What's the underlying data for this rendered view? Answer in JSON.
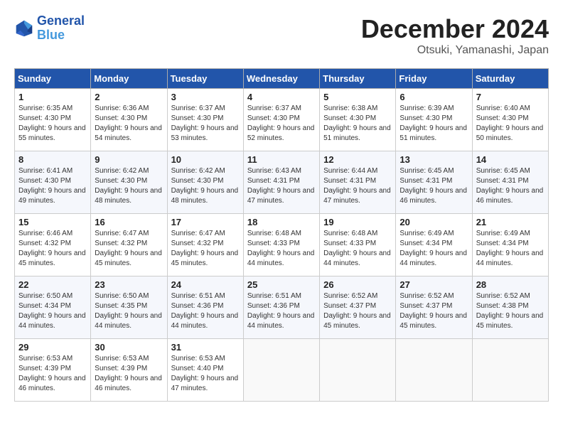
{
  "logo": {
    "line1": "General",
    "line2": "Blue"
  },
  "title": "December 2024",
  "location": "Otsuki, Yamanashi, Japan",
  "days_of_week": [
    "Sunday",
    "Monday",
    "Tuesday",
    "Wednesday",
    "Thursday",
    "Friday",
    "Saturday"
  ],
  "weeks": [
    [
      {
        "day": "1",
        "sunrise": "Sunrise: 6:35 AM",
        "sunset": "Sunset: 4:30 PM",
        "daylight": "Daylight: 9 hours and 55 minutes."
      },
      {
        "day": "2",
        "sunrise": "Sunrise: 6:36 AM",
        "sunset": "Sunset: 4:30 PM",
        "daylight": "Daylight: 9 hours and 54 minutes."
      },
      {
        "day": "3",
        "sunrise": "Sunrise: 6:37 AM",
        "sunset": "Sunset: 4:30 PM",
        "daylight": "Daylight: 9 hours and 53 minutes."
      },
      {
        "day": "4",
        "sunrise": "Sunrise: 6:37 AM",
        "sunset": "Sunset: 4:30 PM",
        "daylight": "Daylight: 9 hours and 52 minutes."
      },
      {
        "day": "5",
        "sunrise": "Sunrise: 6:38 AM",
        "sunset": "Sunset: 4:30 PM",
        "daylight": "Daylight: 9 hours and 51 minutes."
      },
      {
        "day": "6",
        "sunrise": "Sunrise: 6:39 AM",
        "sunset": "Sunset: 4:30 PM",
        "daylight": "Daylight: 9 hours and 51 minutes."
      },
      {
        "day": "7",
        "sunrise": "Sunrise: 6:40 AM",
        "sunset": "Sunset: 4:30 PM",
        "daylight": "Daylight: 9 hours and 50 minutes."
      }
    ],
    [
      {
        "day": "8",
        "sunrise": "Sunrise: 6:41 AM",
        "sunset": "Sunset: 4:30 PM",
        "daylight": "Daylight: 9 hours and 49 minutes."
      },
      {
        "day": "9",
        "sunrise": "Sunrise: 6:42 AM",
        "sunset": "Sunset: 4:30 PM",
        "daylight": "Daylight: 9 hours and 48 minutes."
      },
      {
        "day": "10",
        "sunrise": "Sunrise: 6:42 AM",
        "sunset": "Sunset: 4:30 PM",
        "daylight": "Daylight: 9 hours and 48 minutes."
      },
      {
        "day": "11",
        "sunrise": "Sunrise: 6:43 AM",
        "sunset": "Sunset: 4:31 PM",
        "daylight": "Daylight: 9 hours and 47 minutes."
      },
      {
        "day": "12",
        "sunrise": "Sunrise: 6:44 AM",
        "sunset": "Sunset: 4:31 PM",
        "daylight": "Daylight: 9 hours and 47 minutes."
      },
      {
        "day": "13",
        "sunrise": "Sunrise: 6:45 AM",
        "sunset": "Sunset: 4:31 PM",
        "daylight": "Daylight: 9 hours and 46 minutes."
      },
      {
        "day": "14",
        "sunrise": "Sunrise: 6:45 AM",
        "sunset": "Sunset: 4:31 PM",
        "daylight": "Daylight: 9 hours and 46 minutes."
      }
    ],
    [
      {
        "day": "15",
        "sunrise": "Sunrise: 6:46 AM",
        "sunset": "Sunset: 4:32 PM",
        "daylight": "Daylight: 9 hours and 45 minutes."
      },
      {
        "day": "16",
        "sunrise": "Sunrise: 6:47 AM",
        "sunset": "Sunset: 4:32 PM",
        "daylight": "Daylight: 9 hours and 45 minutes."
      },
      {
        "day": "17",
        "sunrise": "Sunrise: 6:47 AM",
        "sunset": "Sunset: 4:32 PM",
        "daylight": "Daylight: 9 hours and 45 minutes."
      },
      {
        "day": "18",
        "sunrise": "Sunrise: 6:48 AM",
        "sunset": "Sunset: 4:33 PM",
        "daylight": "Daylight: 9 hours and 44 minutes."
      },
      {
        "day": "19",
        "sunrise": "Sunrise: 6:48 AM",
        "sunset": "Sunset: 4:33 PM",
        "daylight": "Daylight: 9 hours and 44 minutes."
      },
      {
        "day": "20",
        "sunrise": "Sunrise: 6:49 AM",
        "sunset": "Sunset: 4:34 PM",
        "daylight": "Daylight: 9 hours and 44 minutes."
      },
      {
        "day": "21",
        "sunrise": "Sunrise: 6:49 AM",
        "sunset": "Sunset: 4:34 PM",
        "daylight": "Daylight: 9 hours and 44 minutes."
      }
    ],
    [
      {
        "day": "22",
        "sunrise": "Sunrise: 6:50 AM",
        "sunset": "Sunset: 4:34 PM",
        "daylight": "Daylight: 9 hours and 44 minutes."
      },
      {
        "day": "23",
        "sunrise": "Sunrise: 6:50 AM",
        "sunset": "Sunset: 4:35 PM",
        "daylight": "Daylight: 9 hours and 44 minutes."
      },
      {
        "day": "24",
        "sunrise": "Sunrise: 6:51 AM",
        "sunset": "Sunset: 4:36 PM",
        "daylight": "Daylight: 9 hours and 44 minutes."
      },
      {
        "day": "25",
        "sunrise": "Sunrise: 6:51 AM",
        "sunset": "Sunset: 4:36 PM",
        "daylight": "Daylight: 9 hours and 44 minutes."
      },
      {
        "day": "26",
        "sunrise": "Sunrise: 6:52 AM",
        "sunset": "Sunset: 4:37 PM",
        "daylight": "Daylight: 9 hours and 45 minutes."
      },
      {
        "day": "27",
        "sunrise": "Sunrise: 6:52 AM",
        "sunset": "Sunset: 4:37 PM",
        "daylight": "Daylight: 9 hours and 45 minutes."
      },
      {
        "day": "28",
        "sunrise": "Sunrise: 6:52 AM",
        "sunset": "Sunset: 4:38 PM",
        "daylight": "Daylight: 9 hours and 45 minutes."
      }
    ],
    [
      {
        "day": "29",
        "sunrise": "Sunrise: 6:53 AM",
        "sunset": "Sunset: 4:39 PM",
        "daylight": "Daylight: 9 hours and 46 minutes."
      },
      {
        "day": "30",
        "sunrise": "Sunrise: 6:53 AM",
        "sunset": "Sunset: 4:39 PM",
        "daylight": "Daylight: 9 hours and 46 minutes."
      },
      {
        "day": "31",
        "sunrise": "Sunrise: 6:53 AM",
        "sunset": "Sunset: 4:40 PM",
        "daylight": "Daylight: 9 hours and 47 minutes."
      },
      null,
      null,
      null,
      null
    ]
  ]
}
